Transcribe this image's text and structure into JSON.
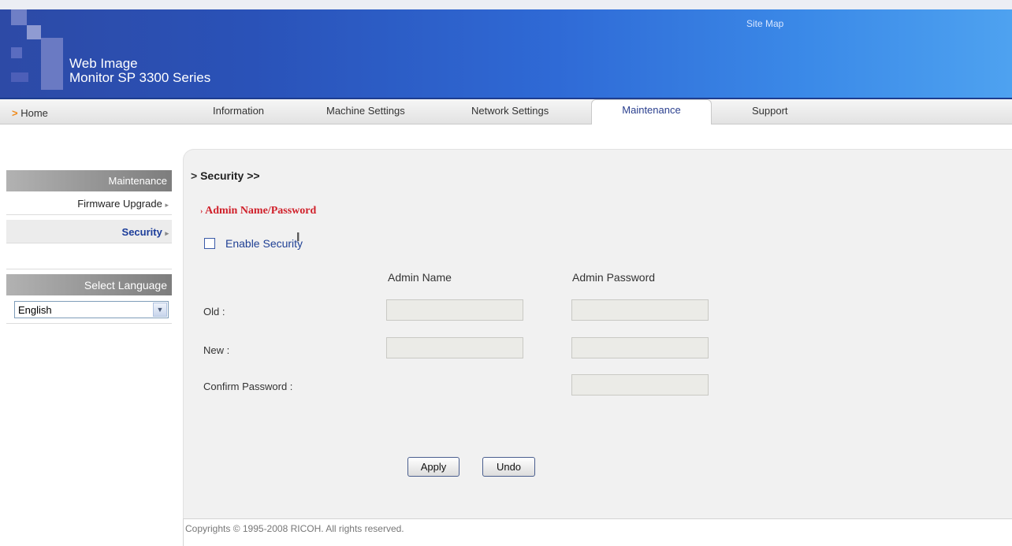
{
  "header": {
    "title_line1": "Web Image",
    "title_line2": "Monitor SP 3300 Series",
    "site_map": "Site Map",
    "brand_color": "#2f6ad6"
  },
  "nav": {
    "home": "Home",
    "home_arrow": ">",
    "items": [
      "Information",
      "Machine Settings",
      "Network Settings",
      "Maintenance",
      "Support"
    ],
    "active": "Maintenance"
  },
  "sidebar": {
    "section1_title": "Maintenance",
    "items": [
      {
        "label": "Firmware Upgrade",
        "selected": false
      },
      {
        "label": "Security",
        "selected": true
      }
    ],
    "item_marker": "▸",
    "section2_title": "Select Language",
    "language": {
      "selected": "English",
      "icon": "chevron-down-icon",
      "glyph": "▼"
    }
  },
  "main": {
    "breadcrumb": "Security >>",
    "breadcrumb_arrow": ">",
    "subsection": "Admin Name/Password",
    "subsection_arrow": "›",
    "enable_security": {
      "label": "Enable Security",
      "checked": false
    },
    "columns": [
      "Admin Name",
      "Admin Password"
    ],
    "rows": [
      {
        "label": "Old :",
        "name_value": "",
        "password_value": ""
      },
      {
        "label": "New :",
        "name_value": "",
        "password_value": ""
      },
      {
        "label": "Confirm Password :",
        "password_value": ""
      }
    ],
    "buttons": {
      "apply": "Apply",
      "undo": "Undo"
    },
    "cursor_icon": "text-cursor-icon",
    "cursor_glyph": "I"
  },
  "footer": {
    "copyright": "Copyrights © 1995-2008 RICOH. All rights reserved."
  },
  "colors": {
    "heading_red": "#d0202a",
    "link_blue": "#1e3f94",
    "panel_bg": "#f1f1f1"
  }
}
